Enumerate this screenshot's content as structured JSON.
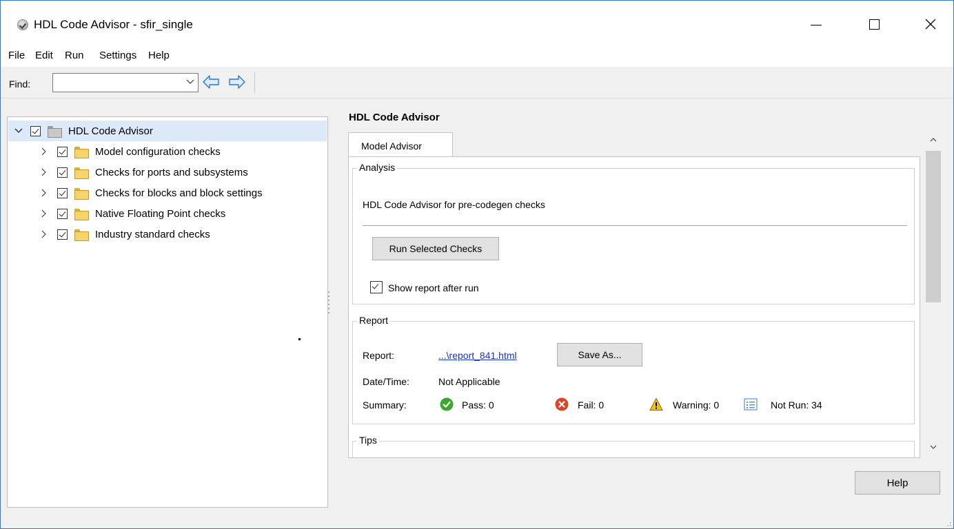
{
  "window": {
    "title": "HDL Code Advisor - sfir_single"
  },
  "menu": [
    "File",
    "Edit",
    "Run",
    "Settings",
    "Help"
  ],
  "toolbar": {
    "find_label": "Find:",
    "find_value": ""
  },
  "tree": {
    "root": "HDL Code Advisor",
    "items": [
      "Model configuration checks",
      "Checks for ports and subsystems",
      "Checks for blocks and block settings",
      "Native Floating Point checks",
      "Industry standard checks"
    ]
  },
  "main": {
    "title": "HDL Code Advisor",
    "tab": "Model Advisor",
    "analysis": {
      "title": "Analysis",
      "description": "HDL Code Advisor for pre-codegen checks",
      "run_button": "Run Selected Checks",
      "show_report_label": "Show report after run",
      "show_report_checked": false
    },
    "report": {
      "title": "Report",
      "report_label": "Report:",
      "report_link": "...\\report_841.html",
      "save_as": "Save As...",
      "datetime_label": "Date/Time:",
      "datetime_value": "Not Applicable",
      "summary_label": "Summary:",
      "pass": "Pass: 0",
      "fail": "Fail: 0",
      "warning": "Warning: 0",
      "not_run": "Not Run: 34"
    },
    "tips": {
      "title": "Tips"
    }
  },
  "footer": {
    "help_button": "Help"
  },
  "colors": {
    "selection": "#dbe9f8",
    "link": "#1a33c7",
    "pass": "#3aa82e",
    "fail": "#d8452a",
    "warning": "#f2c21a"
  },
  "icons": {
    "app": "app-icon",
    "back": "arrow-left-icon",
    "forward": "arrow-right-icon",
    "pass": "pass-check-icon",
    "fail": "fail-x-icon",
    "warning": "warning-triangle-icon",
    "not_run": "not-run-list-icon"
  }
}
